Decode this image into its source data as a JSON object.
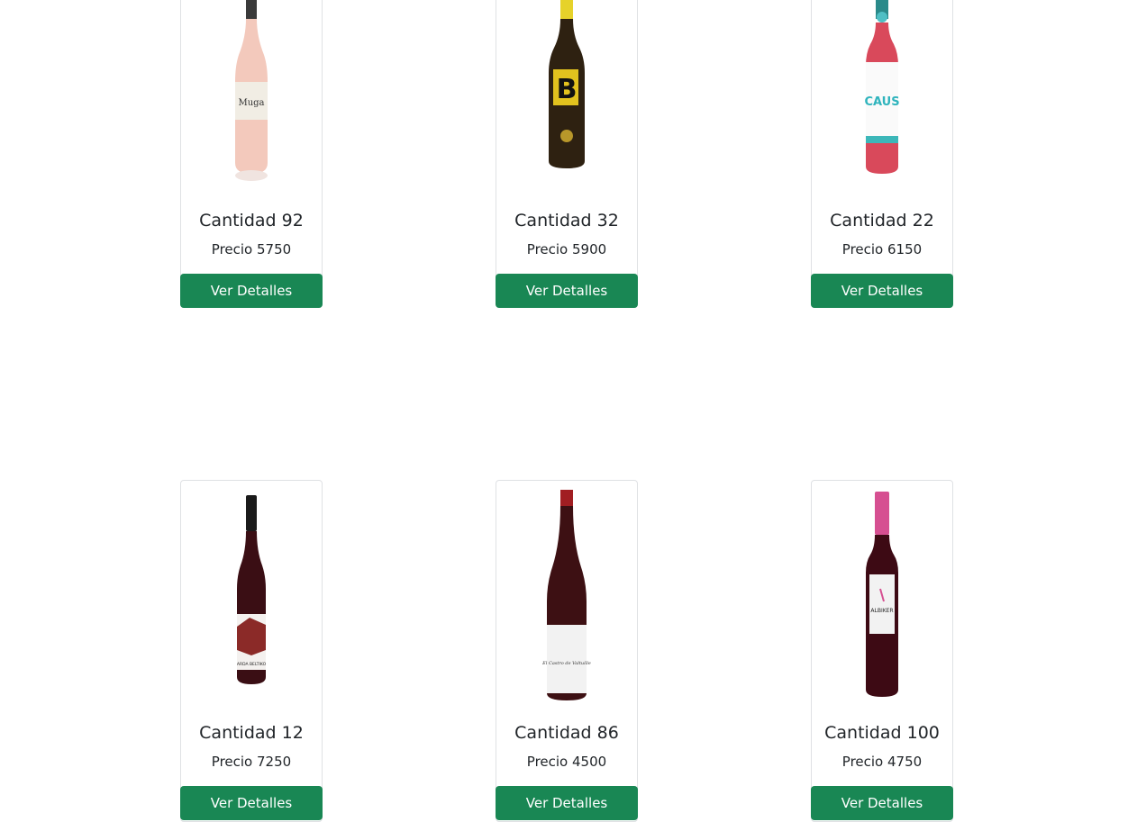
{
  "products": [
    {
      "quantity_label": "Cantidad 92",
      "price_label": "Precio 5750",
      "button_label": "Ver Detalles",
      "label_text": "Muga",
      "color": "#f2c3b6"
    },
    {
      "quantity_label": "Cantidad 32",
      "price_label": "Precio 5900",
      "button_label": "Ver Detalles",
      "label_text": "B",
      "color": "#2b1f10"
    },
    {
      "quantity_label": "Cantidad 22",
      "price_label": "Precio 6150",
      "button_label": "Ver Detalles",
      "label_text": "CAUS",
      "color": "#d94a5c"
    },
    {
      "quantity_label": "Cantidad 12",
      "price_label": "Precio 7250",
      "button_label": "Ver Detalles",
      "label_text": "ARDA BELTIKO",
      "color": "#3a0e14"
    },
    {
      "quantity_label": "Cantidad 86",
      "price_label": "Precio 4500",
      "button_label": "Ver Detalles",
      "label_text": "El Castro de Valtuille",
      "color": "#3b0f12"
    },
    {
      "quantity_label": "Cantidad 100",
      "price_label": "Precio 4750",
      "button_label": "Ver Detalles",
      "label_text": "ALBIKER",
      "color": "#3d0a14"
    }
  ],
  "colors": {
    "button": "#198754",
    "card_border": "#dfe1e4"
  }
}
